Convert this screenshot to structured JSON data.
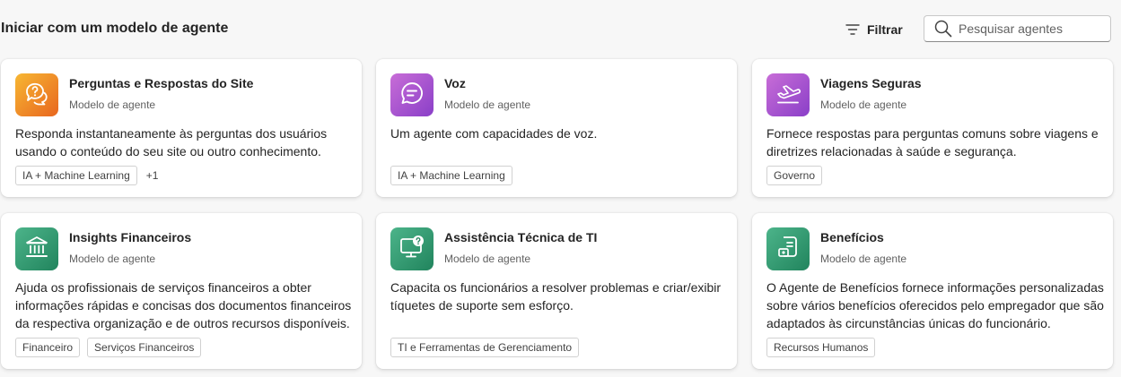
{
  "header": {
    "title": "Iniciar com um modelo de agente",
    "filter_label": "Filtrar",
    "search_placeholder": "Pesquisar agentes"
  },
  "cards": [
    {
      "name": "Perguntas e Respostas do Site",
      "subtitle": "Modelo de agente",
      "description": "Responda instantaneamente às perguntas dos usuários usando o conteúdo do seu site ou outro conhecimento.",
      "tags": [
        "IA + Machine Learning"
      ],
      "more": "+1",
      "icon": "question-chat-icon",
      "color_from": "#f7b733",
      "color_to": "#e8661f"
    },
    {
      "name": "Voz",
      "subtitle": "Modelo de agente",
      "description": "Um agente com capacidades de voz.",
      "tags": [
        "IA + Machine Learning"
      ],
      "icon": "chat-bubble-icon",
      "color_from": "#c86dd7",
      "color_to": "#8a3fc8"
    },
    {
      "name": "Viagens Seguras",
      "subtitle": "Modelo de agente",
      "description": "Fornece respostas para perguntas comuns sobre viagens e diretrizes relacionadas à saúde e segurança.",
      "tags": [
        "Governo"
      ],
      "icon": "airplane-icon",
      "color_from": "#c86dd7",
      "color_to": "#8a3fc8"
    },
    {
      "name": "Insights Financeiros",
      "subtitle": "Modelo de agente",
      "description": "Ajuda os profissionais de serviços financeiros a obter informações rápidas e concisas dos documentos financeiros da respectiva organização e de outros recursos disponíveis.",
      "tags": [
        "Financeiro",
        "Serviços Financeiros"
      ],
      "icon": "bank-icon",
      "color_from": "#4cb48a",
      "color_to": "#21845d"
    },
    {
      "name": "Assistência Técnica de TI",
      "subtitle": "Modelo de agente",
      "description": "Capacita os funcionários a resolver problemas e criar/exibir tíquetes de suporte sem esforço.",
      "tags": [
        "TI e Ferramentas de Gerenciamento"
      ],
      "icon": "computer-help-icon",
      "color_from": "#4cb48a",
      "color_to": "#21845d"
    },
    {
      "name": "Benefícios",
      "subtitle": "Modelo de agente",
      "description": "O Agente de Benefícios fornece informações personalizadas sobre vários benefícios oferecidos pelo empregador que são adaptados às circunstâncias únicas do funcionário.",
      "tags": [
        "Recursos Humanos"
      ],
      "icon": "benefits-document-icon",
      "color_from": "#4cb48a",
      "color_to": "#21845d"
    }
  ]
}
